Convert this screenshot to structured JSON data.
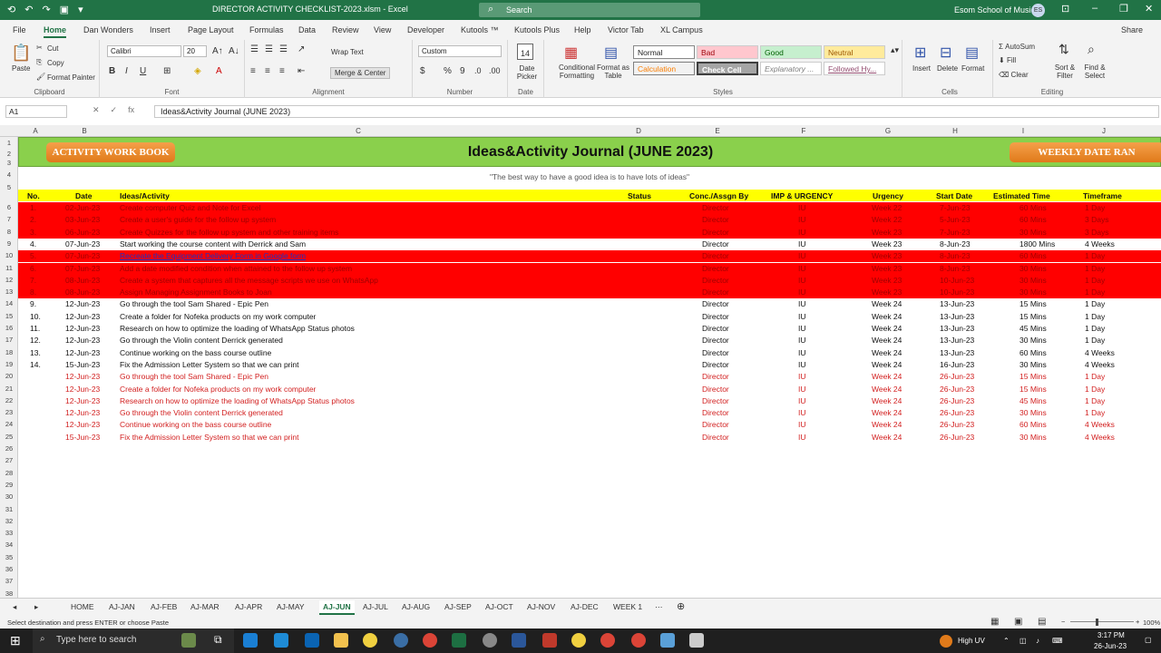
{
  "window": {
    "title": "DIRECTOR ACTIVITY CHECKLIST-2023.xlsm  -  Excel",
    "search": "Search",
    "user": "Esom School of Music",
    "initials": "ES"
  },
  "menu": [
    "File",
    "Home",
    "Dan Wonders",
    "Insert",
    "Page Layout",
    "Formulas",
    "Data",
    "Review",
    "View",
    "Developer",
    "Kutools ™",
    "Kutools Plus",
    "Help",
    "Victor Tab",
    "XL Campus"
  ],
  "share": "Share",
  "ribbon": {
    "clipboard": {
      "paste": "Paste",
      "cut": "Cut",
      "copy": "Copy",
      "painter": "Format Painter",
      "label": "Clipboard"
    },
    "font": {
      "name": "Calibri",
      "size": "20",
      "label": "Font"
    },
    "alignment": {
      "wrap": "Wrap Text",
      "merge": "Merge & Center",
      "label": "Alignment"
    },
    "number": {
      "format": "Custom",
      "label": "Number"
    },
    "date": {
      "picker": "Date Picker",
      "num": "14",
      "label": "Date"
    },
    "styles": {
      "cond": "Conditional Formatting",
      "table": "Format as Table",
      "normal": "Normal",
      "bad": "Bad",
      "good": "Good",
      "neutral": "Neutral",
      "calc": "Calculation",
      "check": "Check Cell",
      "expl": "Explanatory ...",
      "followed": "Followed Hy...",
      "label": "Styles"
    },
    "cells": {
      "insert": "Insert",
      "delete": "Delete",
      "format": "Format",
      "label": "Cells"
    },
    "editing": {
      "autosum": "AutoSum",
      "fill": "Fill",
      "clear": "Clear",
      "sort": "Sort & Filter",
      "find": "Find & Select",
      "label": "Editing"
    }
  },
  "formula": {
    "cell": "A1",
    "content": "Ideas&Activity Journal (JUNE 2023)"
  },
  "columns": [
    "A",
    "B",
    "C",
    "D",
    "E",
    "F",
    "G",
    "H",
    "I",
    "J"
  ],
  "sheet": {
    "btn_left": "ACTIVITY WORK BOOK",
    "title": "Ideas&Activity Journal (JUNE 2023)",
    "btn_right": "WEEKLY DATE RAN",
    "quote": "\"The best way to have a good idea is to have lots of ideas\"",
    "headers": [
      "No.",
      "Date",
      "Ideas/Activity",
      "Status",
      "Conc./Assgn By",
      "IMP & URGENCY",
      "Urgency",
      "Start Date",
      "Estimated Time",
      "Timeframe"
    ],
    "rows": [
      {
        "t": "red",
        "no": "1.",
        "date": "02-Jun-23",
        "act": "Create computer Quiz and Note for Excel",
        "by": "Director",
        "imp": "IU",
        "urg": "Week 22",
        "start": "7-Jun-23",
        "est": "60 Mins",
        "tf": "1 Day"
      },
      {
        "t": "red",
        "no": "2.",
        "date": "03-Jun-23",
        "act": "Create a user's guide for the follow up system",
        "by": "Director",
        "imp": "IU",
        "urg": "Week 22",
        "start": "5-Jun-23",
        "est": "60 Mins",
        "tf": "3 Days"
      },
      {
        "t": "red",
        "no": "3.",
        "date": "06-Jun-23",
        "act": "Create Quizzes for the follow up system and other training items",
        "by": "Director",
        "imp": "IU",
        "urg": "Week 23",
        "start": "7-Jun-23",
        "est": "30 Mins",
        "tf": "3 Days"
      },
      {
        "t": "white",
        "no": "4.",
        "date": "07-Jun-23",
        "act": "Start working the course content with Derrick and Sam",
        "by": "Director",
        "imp": "IU",
        "urg": "Week 23",
        "start": "8-Jun-23",
        "est": "1800 Mins",
        "tf": "4 Weeks"
      },
      {
        "t": "red",
        "no": "5.",
        "date": "07-Jun-23",
        "act": "Recreate the Equipment Delivery Form in Google form",
        "by": "Director",
        "imp": "IU",
        "urg": "Week 23",
        "start": "8-Jun-23",
        "est": "60 Mins",
        "tf": "1 Day",
        "link": true
      },
      {
        "t": "red",
        "no": "6.",
        "date": "07-Jun-23",
        "act": "Add a date modified condition when attained to the follow up system",
        "by": "Director",
        "imp": "IU",
        "urg": "Week 23",
        "start": "8-Jun-23",
        "est": "30 Mins",
        "tf": "1 Day"
      },
      {
        "t": "red",
        "no": "7.",
        "date": "08-Jun-23",
        "act": "Create a system that captures all the message scripts we use on WhatsApp",
        "by": "Director",
        "imp": "IU",
        "urg": "Week 23",
        "start": "10-Jun-23",
        "est": "30 Mins",
        "tf": "1 Day"
      },
      {
        "t": "red",
        "no": "8.",
        "date": "08-Jun-23",
        "act": "Assign Managing Assignment Books to Joan",
        "by": "Director",
        "imp": "IU",
        "urg": "Week 23",
        "start": "10-Jun-23",
        "est": "30 Mins",
        "tf": "1 Day"
      },
      {
        "t": "white",
        "no": "9.",
        "date": "12-Jun-23",
        "act": "Go through the tool Sam Shared - Epic Pen",
        "by": "Director",
        "imp": "IU",
        "urg": "Week 24",
        "start": "13-Jun-23",
        "est": "15 Mins",
        "tf": "1 Day"
      },
      {
        "t": "white",
        "no": "10.",
        "date": "12-Jun-23",
        "act": "Create a folder for Nofeka products on my work computer",
        "by": "Director",
        "imp": "IU",
        "urg": "Week 24",
        "start": "13-Jun-23",
        "est": "15 Mins",
        "tf": "1 Day"
      },
      {
        "t": "white",
        "no": "11.",
        "date": "12-Jun-23",
        "act": "Research on how to optimize the loading of WhatsApp Status photos",
        "by": "Director",
        "imp": "IU",
        "urg": "Week 24",
        "start": "13-Jun-23",
        "est": "45 Mins",
        "tf": "1 Day"
      },
      {
        "t": "white",
        "no": "12.",
        "date": "12-Jun-23",
        "act": "Go through the Violin content Derrick generated",
        "by": "Director",
        "imp": "IU",
        "urg": "Week 24",
        "start": "13-Jun-23",
        "est": "30 Mins",
        "tf": "1 Day"
      },
      {
        "t": "white",
        "no": "13.",
        "date": "12-Jun-23",
        "act": "Continue working on the bass course outline",
        "by": "Director",
        "imp": "IU",
        "urg": "Week 24",
        "start": "13-Jun-23",
        "est": "60 Mins",
        "tf": "4 Weeks"
      },
      {
        "t": "white",
        "no": "14.",
        "date": "15-Jun-23",
        "act": "Fix the Admission Letter System so that we can print",
        "by": "Director",
        "imp": "IU",
        "urg": "Week 24",
        "start": "16-Jun-23",
        "est": "30 Mins",
        "tf": "4 Weeks"
      },
      {
        "t": "plain",
        "no": "",
        "date": "12-Jun-23",
        "act": "Go through the tool Sam Shared - Epic Pen",
        "by": "Director",
        "imp": "IU",
        "urg": "Week 24",
        "start": "26-Jun-23",
        "est": "15 Mins",
        "tf": "1 Day"
      },
      {
        "t": "plain",
        "no": "",
        "date": "12-Jun-23",
        "act": "Create a folder for Nofeka products on my work computer",
        "by": "Director",
        "imp": "IU",
        "urg": "Week 24",
        "start": "26-Jun-23",
        "est": "15 Mins",
        "tf": "1 Day"
      },
      {
        "t": "plain",
        "no": "",
        "date": "12-Jun-23",
        "act": "Research on how to optimize the loading of WhatsApp Status photos",
        "by": "Director",
        "imp": "IU",
        "urg": "Week 24",
        "start": "26-Jun-23",
        "est": "45 Mins",
        "tf": "1 Day"
      },
      {
        "t": "plain",
        "no": "",
        "date": "12-Jun-23",
        "act": "Go through the Violin content Derrick generated",
        "by": "Director",
        "imp": "IU",
        "urg": "Week 24",
        "start": "26-Jun-23",
        "est": "30 Mins",
        "tf": "1 Day"
      },
      {
        "t": "plain",
        "no": "",
        "date": "12-Jun-23",
        "act": "Continue working on the bass course outline",
        "by": "Director",
        "imp": "IU",
        "urg": "Week 24",
        "start": "26-Jun-23",
        "est": "60 Mins",
        "tf": "4 Weeks"
      },
      {
        "t": "plain",
        "no": "",
        "date": "15-Jun-23",
        "act": "Fix the Admission Letter System so that we can print",
        "by": "Director",
        "imp": "IU",
        "urg": "Week 24",
        "start": "26-Jun-23",
        "est": "30 Mins",
        "tf": "4 Weeks"
      }
    ]
  },
  "sheet_tabs": [
    "HOME",
    "AJ-JAN",
    "AJ-FEB",
    "AJ-MAR",
    "AJ-APR",
    "AJ-MAY",
    "AJ-JUN",
    "AJ-JUL",
    "AJ-AUG",
    "AJ-SEP",
    "AJ-OCT",
    "AJ-NOV",
    "AJ-DEC",
    "WEEK 1"
  ],
  "active_tab": "AJ-JUN",
  "status": {
    "msg": "Select destination and press ENTER or choose Paste",
    "zoom": "100%"
  },
  "taskbar": {
    "search": "Type here to search",
    "weather": "High UV",
    "time": "3:17 PM",
    "date": "26-Jun-23"
  }
}
